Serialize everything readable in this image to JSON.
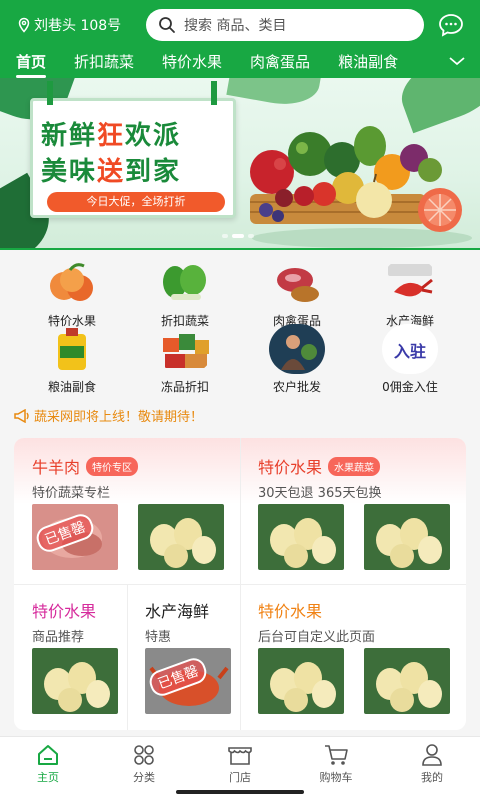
{
  "header": {
    "location": "刘巷头 108号",
    "search_placeholder": "搜索 商品、类目",
    "tabs": [
      "首页",
      "折扣蔬菜",
      "特价水果",
      "肉禽蛋品",
      "粮油副食"
    ]
  },
  "banner": {
    "line1_a": "新鲜",
    "line1_b": "狂",
    "line1_c": "欢派",
    "line2_a": "美味",
    "line2_b": "送",
    "line2_c": "到家",
    "tag": "今日大促，全场打折"
  },
  "categories": [
    {
      "label": "特价水果",
      "icon": "peach-icon"
    },
    {
      "label": "折扣蔬菜",
      "icon": "greens-icon"
    },
    {
      "label": "肉禽蛋品",
      "icon": "meat-icon"
    },
    {
      "label": "水产海鲜",
      "icon": "lobster-icon"
    },
    {
      "label": "粮油副食",
      "icon": "oil-icon"
    },
    {
      "label": "冻品折扣",
      "icon": "frozen-icon"
    },
    {
      "label": "农户批发",
      "icon": "farmer-icon"
    },
    {
      "label": "0佣金入住",
      "icon": "join-icon",
      "icon_text": "入驻"
    }
  ],
  "notice": "蔬采网即将上线！敬请期待！",
  "blocks": {
    "b1": {
      "title": "牛羊肉",
      "badge": "特价专区",
      "sub": "特价蔬菜专栏",
      "title_color": "#e8402c"
    },
    "b2": {
      "title": "特价水果",
      "badge": "水果蔬菜",
      "sub": "30天包退 365天包换",
      "title_color": "#e8402c"
    },
    "b3": {
      "title": "特价水果",
      "sub": "商品推荐",
      "title_color": "#d62b9c"
    },
    "b4": {
      "title": "水产海鲜",
      "sub": "特惠",
      "title_color": "#222222"
    },
    "b5": {
      "title": "特价水果",
      "sub": "后台可自定义此页面",
      "title_color": "#f08214"
    },
    "sold_out": "已售罄"
  },
  "bottom_nav": [
    {
      "label": "主页",
      "icon": "home-icon",
      "active": true
    },
    {
      "label": "分类",
      "icon": "category-icon"
    },
    {
      "label": "门店",
      "icon": "store-icon"
    },
    {
      "label": "购物车",
      "icon": "cart-icon"
    },
    {
      "label": "我的",
      "icon": "user-icon"
    }
  ],
  "colors": {
    "brand_green": "#18a843",
    "accent_red": "#f15a2b",
    "notice_orange": "#e88a10"
  }
}
